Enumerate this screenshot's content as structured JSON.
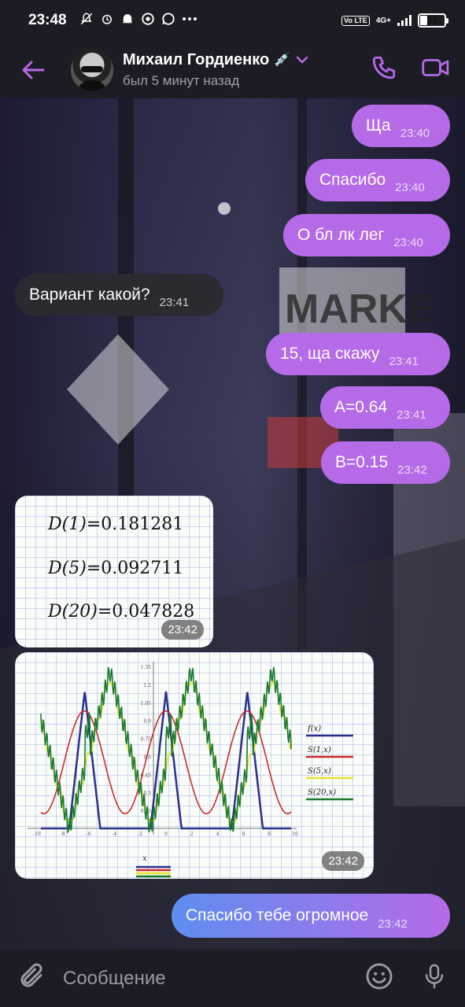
{
  "status_bar": {
    "time": "23:48",
    "network": "4G+",
    "volte": "Vo LTE",
    "battery": "27",
    "battery_level": 0.27,
    "notification_icons": [
      "mute-icon",
      "alarm-icon",
      "ghost-icon",
      "coin-icon",
      "whatsapp-icon",
      "more-dots-icon"
    ]
  },
  "header": {
    "contact_name": "Михаил Гордиенко",
    "contact_emoji": "💉",
    "contact_status": "был 5 минут назад"
  },
  "messages": [
    {
      "id": "m1",
      "side": "out",
      "text": "Ща",
      "time": "23:40"
    },
    {
      "id": "m2",
      "side": "out",
      "text": "Спасибо",
      "time": "23:40"
    },
    {
      "id": "m3",
      "side": "out",
      "text": "О бл лк лег",
      "time": "23:40"
    },
    {
      "id": "m4",
      "side": "in",
      "text": "Вариант какой?",
      "time": "23:41"
    },
    {
      "id": "m5",
      "side": "out",
      "text": "15, ща скажу",
      "time": "23:41"
    },
    {
      "id": "m6",
      "side": "out",
      "text": "A=0.64",
      "time": "23:41"
    },
    {
      "id": "m7",
      "side": "out",
      "text": "B=0.15",
      "time": "23:42"
    },
    {
      "id": "m8",
      "side": "in",
      "type": "image",
      "time": "23:42",
      "formulas": [
        {
          "label": "D(1)",
          "value": "0.181281"
        },
        {
          "label": "D(5)",
          "value": "0.092711"
        },
        {
          "label": "D(20)",
          "value": "0.047828"
        }
      ]
    },
    {
      "id": "m9",
      "side": "in",
      "type": "image",
      "time": "23:42",
      "plot": {
        "ytick_top": "1.35",
        "yticks": [
          "1.2",
          "1.05",
          "0.9",
          "0.75",
          "0.6",
          "0.45",
          "0.3",
          "0.15"
        ],
        "xticks": [
          "-10",
          "-8",
          "-6",
          "-4",
          "-2",
          "0",
          "2",
          "4",
          "6",
          "8",
          "10"
        ],
        "x_axis_label": "x",
        "legend": [
          {
            "label": "f(x)",
            "color": "#2a2f8a"
          },
          {
            "label": "S(1,x)",
            "color": "#cc2a2a"
          },
          {
            "label": "S(5,x)",
            "color": "#e6e22a"
          },
          {
            "label": "S(20,x)",
            "color": "#1b7a2e"
          }
        ]
      }
    },
    {
      "id": "m10",
      "side": "out",
      "text": "Спасибо тебе огромное",
      "time": "23:42"
    }
  ],
  "input": {
    "placeholder": "Сообщение"
  },
  "colors": {
    "outgoing_bubble": "#b56ae8",
    "incoming_bubble": "#2a2a30",
    "accent": "#b56ae8"
  }
}
